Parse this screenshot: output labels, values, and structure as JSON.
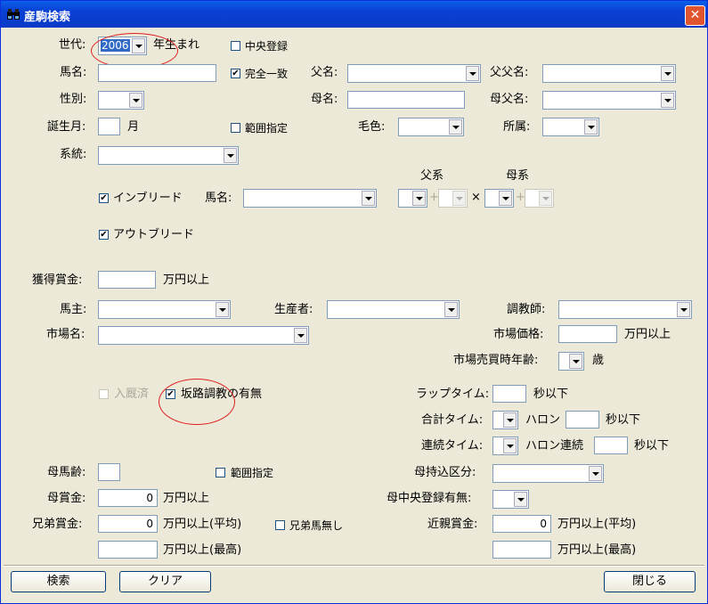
{
  "window": {
    "title": "産駒検索",
    "close_glyph": "✕"
  },
  "labels": {
    "generation": "世代:",
    "born_year": "年生まれ",
    "central_reg": "中央登録",
    "horse_name": "馬名:",
    "exact_match": "完全一致",
    "sire_name": "父名:",
    "sire_sire_name": "父父名:",
    "sex": "性別:",
    "dam_name": "母名:",
    "dam_sire_name": "母父名:",
    "birth_month": "誕生月:",
    "month_unit": "月",
    "range_spec": "範囲指定",
    "coat_color": "毛色:",
    "affiliation": "所属:",
    "lineage": "系統:",
    "sire_line": "父系",
    "dam_line": "母系",
    "inbreed": "インブリード",
    "inbreed_horse_name": "馬名:",
    "plus1": "+",
    "cross": "×",
    "plus2": "+",
    "outbreed": "アウトブリード",
    "earned_prize": "獲得賞金:",
    "man_yen_or_more": "万円以上",
    "owner": "馬主:",
    "breeder": "生産者:",
    "trainer": "調教師:",
    "market_name": "市場名:",
    "market_price": "市場価格:",
    "market_price_unit": "万円以上",
    "market_sale_age": "市場売買時年齢:",
    "age_unit": "歳",
    "in_stable": "入厩済",
    "slope_training": "坂路調教の有無",
    "lap_time": "ラップタイム:",
    "sec_or_less1": "秒以下",
    "total_time": "合計タイム:",
    "furlong": "ハロン",
    "sec_or_less2": "秒以下",
    "consecutive_time": "連続タイム:",
    "furlong_consecutive": "ハロン連続",
    "sec_or_less3": "秒以下",
    "dam_age": "母馬齢:",
    "range_spec2": "範囲指定",
    "dam_import": "母持込区分:",
    "dam_prize": "母賞金:",
    "man_yen_or_more2": "万円以上",
    "dam_central_reg": "母中央登録有無:",
    "sibling_prize": "兄弟賞金:",
    "man_yen_avg": "万円以上(平均)",
    "no_siblings": "兄弟馬無し",
    "relative_prize": "近親賞金:",
    "man_yen_avg2": "万円以上(平均)",
    "man_yen_max": "万円以上(最高)",
    "man_yen_max2": "万円以上(最高)"
  },
  "values": {
    "generation": "2006",
    "dam_prize": "0",
    "sibling_prize": "0",
    "relative_prize": "0"
  },
  "checkboxes": {
    "central_reg": false,
    "exact_match": true,
    "range_spec": false,
    "inbreed": true,
    "outbreed": true,
    "in_stable": false,
    "slope_training": true,
    "range_spec2": false,
    "no_siblings": false
  },
  "check_glyph": "✔",
  "buttons": {
    "search": "検索",
    "clear": "クリア",
    "close": "閉じる"
  },
  "colors": {
    "titlebar": "#0a3ac6",
    "annotation": "#e02020",
    "selection": "#316ac5"
  }
}
